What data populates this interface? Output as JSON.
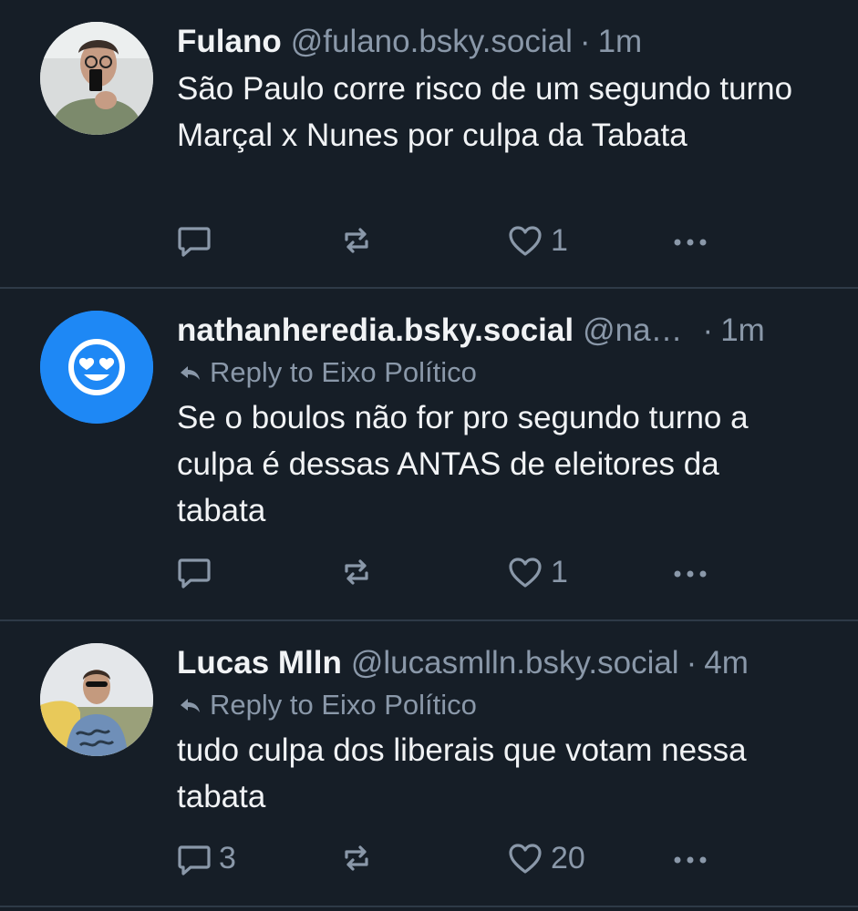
{
  "colors": {
    "background": "#161e27",
    "text": "#f1f3f5",
    "muted": "#8a98a9",
    "divider": "#2e3a47",
    "avatar_blue": "#1e88f5"
  },
  "posts": [
    {
      "author": {
        "name": "Fulano",
        "handle": "@fulano.bsky.social",
        "avatar": "photo-avatar"
      },
      "time": "1m",
      "reply_to": "",
      "text": "São Paulo corre risco de um segundo turno Marçal x Nunes por culpa da Tabata",
      "replies": "",
      "reposts": "",
      "likes": "1"
    },
    {
      "author": {
        "name": "nathanheredia.bsky.social",
        "handle": "@na…",
        "avatar": "heart-eyes-smiley-icon"
      },
      "time": "1m",
      "reply_to": "Reply to Eixo Político",
      "text": "Se o boulos não for pro segundo turno a culpa é dessas ANTAS de eleitores da tabata",
      "replies": "",
      "reposts": "",
      "likes": "1"
    },
    {
      "author": {
        "name": "Lucas Mlln",
        "handle": "@lucasmlln.bsky.social",
        "avatar": "photo-avatar"
      },
      "time": "4m",
      "reply_to": "Reply to Eixo Político",
      "text": "tudo culpa dos liberais que votam nessa tabata",
      "replies": "3",
      "reposts": "",
      "likes": "20"
    }
  ],
  "separator": "·"
}
